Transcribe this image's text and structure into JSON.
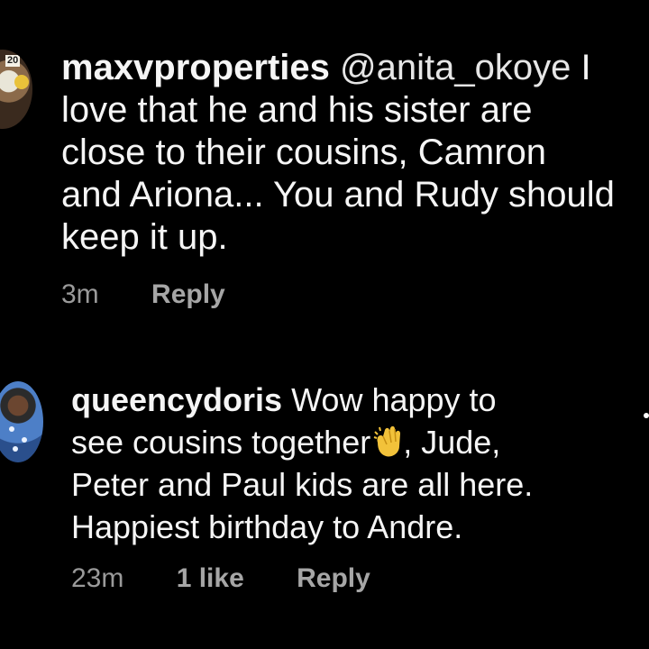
{
  "comments": [
    {
      "username": "maxvproperties",
      "mention": "@anita_okoye",
      "text_lines": [
        "I",
        "love that he and his sister are",
        "close to their cousins, Camron",
        "and Ariona... You and Rudy should",
        "keep it up."
      ],
      "time": "3m",
      "likes": "",
      "reply_label": "Reply",
      "avatar_text": "20"
    },
    {
      "username": "queencydoris",
      "text_lines": [
        "Wow happy to",
        "see cousins together",
        ", Jude,",
        "Peter and Paul kids are all here.",
        "Happiest birthday to Andre."
      ],
      "emoji": "clapping-hands",
      "time": "23m",
      "likes": "1 like",
      "reply_label": "Reply"
    }
  ],
  "colors": {
    "background": "#000000",
    "text": "#f5f5f5",
    "meta": "#9a9a9a"
  }
}
